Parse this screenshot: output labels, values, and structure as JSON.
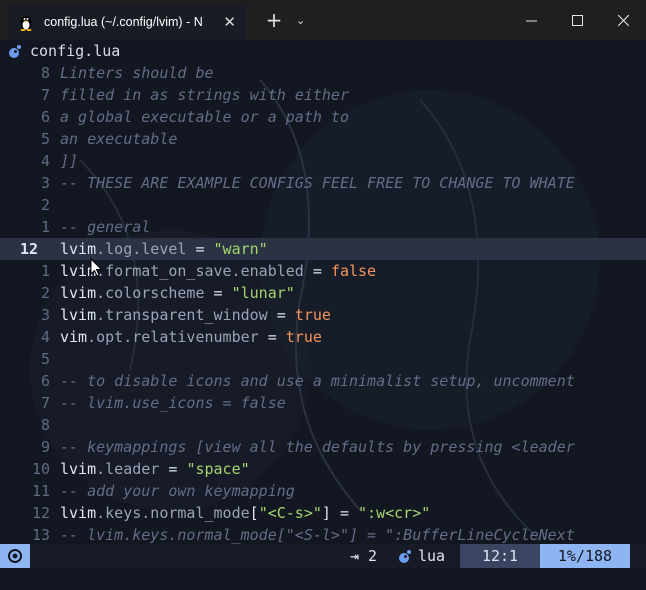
{
  "window": {
    "tab_title": "config.lua (~/.config/lvim) - N",
    "tab_close": "✕",
    "new_tab": "+",
    "dropdown": "⌄",
    "minimize": "—",
    "maximize": "☐",
    "close": "✕"
  },
  "winbar": {
    "filename": "config.lua"
  },
  "editor": {
    "lines": [
      {
        "num": "8",
        "tokens": [
          {
            "t": "cm",
            "v": "Linters should be"
          }
        ]
      },
      {
        "num": "7",
        "tokens": [
          {
            "t": "cm",
            "v": "filled in as strings with either"
          }
        ]
      },
      {
        "num": "6",
        "tokens": [
          {
            "t": "cm",
            "v": "a global executable or a path to"
          }
        ]
      },
      {
        "num": "5",
        "tokens": [
          {
            "t": "cm",
            "v": "an executable"
          }
        ]
      },
      {
        "num": "4",
        "tokens": [
          {
            "t": "cm",
            "v": "]]"
          }
        ]
      },
      {
        "num": "3",
        "tokens": [
          {
            "t": "cm",
            "v": "-- THESE ARE EXAMPLE CONFIGS FEEL FREE TO CHANGE TO WHATE"
          }
        ]
      },
      {
        "num": "2",
        "tokens": []
      },
      {
        "num": "1",
        "tokens": [
          {
            "t": "cm",
            "v": "-- general"
          }
        ]
      },
      {
        "num": "12",
        "current": true,
        "tokens": [
          {
            "t": "id",
            "v": "lvim"
          },
          {
            "t": "prop",
            "v": ".log.level"
          },
          {
            "t": "id",
            "v": " = "
          },
          {
            "t": "str",
            "v": "\"warn\""
          }
        ]
      },
      {
        "num": "1",
        "tokens": [
          {
            "t": "id",
            "v": "lvim"
          },
          {
            "t": "prop",
            "v": ".format_on_save.enabled"
          },
          {
            "t": "id",
            "v": " = "
          },
          {
            "t": "kw",
            "v": "false"
          }
        ]
      },
      {
        "num": "2",
        "tokens": [
          {
            "t": "id",
            "v": "lvim"
          },
          {
            "t": "prop",
            "v": ".colorscheme"
          },
          {
            "t": "id",
            "v": " = "
          },
          {
            "t": "str",
            "v": "\"lunar\""
          }
        ]
      },
      {
        "num": "3",
        "tokens": [
          {
            "t": "id",
            "v": "lvim"
          },
          {
            "t": "prop",
            "v": ".transparent_window"
          },
          {
            "t": "id",
            "v": " = "
          },
          {
            "t": "kw",
            "v": "true"
          }
        ]
      },
      {
        "num": "4",
        "tokens": [
          {
            "t": "id",
            "v": "vim"
          },
          {
            "t": "prop",
            "v": ".opt.relativenumber"
          },
          {
            "t": "id",
            "v": " = "
          },
          {
            "t": "kw",
            "v": "true"
          }
        ]
      },
      {
        "num": "5",
        "tokens": []
      },
      {
        "num": "6",
        "tokens": [
          {
            "t": "cm",
            "v": "-- to disable icons and use a minimalist setup, uncomment"
          }
        ]
      },
      {
        "num": "7",
        "tokens": [
          {
            "t": "cm",
            "v": "-- lvim.use_icons = false"
          }
        ]
      },
      {
        "num": "8",
        "tokens": []
      },
      {
        "num": "9",
        "tokens": [
          {
            "t": "cm",
            "v": "-- keymappings [view all the defaults by pressing <leader"
          }
        ]
      },
      {
        "num": "10",
        "tokens": [
          {
            "t": "id",
            "v": "lvim"
          },
          {
            "t": "prop",
            "v": ".leader"
          },
          {
            "t": "id",
            "v": " = "
          },
          {
            "t": "str",
            "v": "\"space\""
          }
        ]
      },
      {
        "num": "11",
        "tokens": [
          {
            "t": "cm",
            "v": "-- add your own keymapping"
          }
        ]
      },
      {
        "num": "12",
        "tokens": [
          {
            "t": "id",
            "v": "lvim"
          },
          {
            "t": "prop",
            "v": ".keys.normal_mode"
          },
          {
            "t": "id",
            "v": "["
          },
          {
            "t": "str",
            "v": "\"<C-s>\""
          },
          {
            "t": "id",
            "v": "] = "
          },
          {
            "t": "str",
            "v": "\":w<cr>\""
          }
        ]
      },
      {
        "num": "13",
        "tokens": [
          {
            "t": "cm",
            "v": "-- lvim.keys.normal_mode[\"<S-l>\"] = \":BufferLineCycleNext"
          }
        ]
      }
    ]
  },
  "statusline": {
    "spaces": "⇥ 2",
    "filetype": "lua",
    "position": "12:1",
    "percent": "1%/188"
  },
  "colors": {
    "background": "#131722",
    "accent": "#8fb4f2",
    "string": "#a6d56f",
    "keyword": "#f2945a",
    "comment": "#646c87"
  }
}
